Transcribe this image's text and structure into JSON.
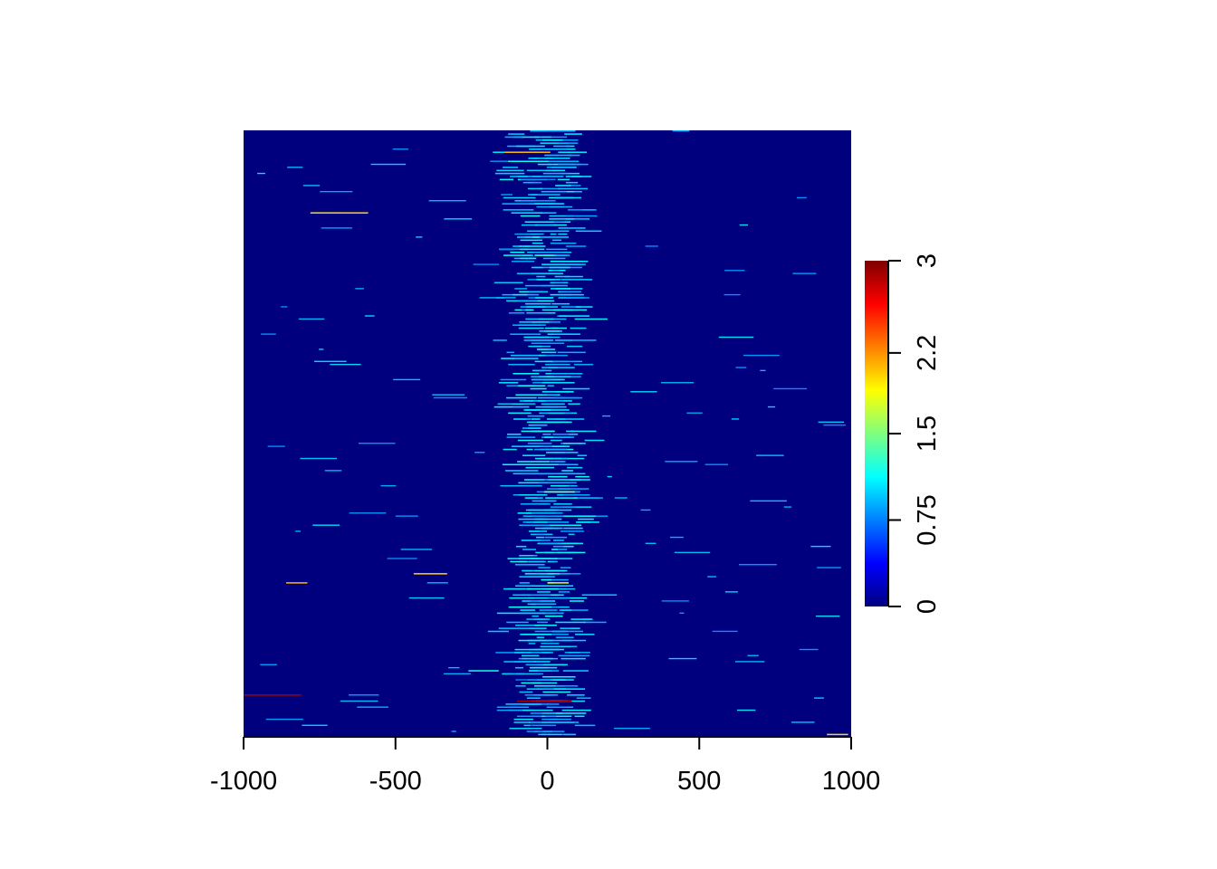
{
  "chart_data": {
    "type": "heatmap",
    "title": "",
    "xlabel": "",
    "ylabel": "",
    "xlim": [
      -1000,
      1000
    ],
    "x_ticks": [
      -1000,
      -500,
      0,
      500,
      1000
    ],
    "x_tick_labels": [
      "-1000",
      "-500",
      "0",
      "500",
      "1000"
    ],
    "rows": 200,
    "background_value": 0,
    "colorbar": {
      "range": [
        0,
        3
      ],
      "ticks": [
        0,
        0.75,
        1.5,
        2.2,
        3
      ],
      "tick_labels": [
        "0",
        "0.75",
        "1.5",
        "2.2",
        "3"
      ],
      "colormap": "jet",
      "colors": [
        "#00007F",
        "#0000FF",
        "#007FFF",
        "#00FFFF",
        "#7FFF7F",
        "#FFFF00",
        "#FF7F00",
        "#FF0000",
        "#7F0000"
      ]
    },
    "segments": [
      {
        "row": 7,
        "x0": -140,
        "x1": 10,
        "value": 2.1
      },
      {
        "row": 27,
        "x0": -780,
        "x1": -590,
        "value": 2.0
      },
      {
        "row": 119,
        "x0": -10,
        "x1": 90,
        "value": 1.6
      },
      {
        "row": 146,
        "x0": -440,
        "x1": -330,
        "value": 2.0
      },
      {
        "row": 149,
        "x0": -860,
        "x1": -790,
        "value": 2.1
      },
      {
        "row": 149,
        "x0": 0,
        "x1": 70,
        "value": 1.8
      },
      {
        "row": 186,
        "x0": -1000,
        "x1": -810,
        "value": 2.9
      },
      {
        "row": 188,
        "x0": -100,
        "x1": 80,
        "value": 2.9
      },
      {
        "row": 199,
        "x0": 920,
        "x1": 990,
        "value": 2.0
      },
      {
        "row": 55,
        "x0": -40,
        "x1": 20,
        "value": 1.1
      },
      {
        "row": 59,
        "x0": 20,
        "x1": 130,
        "value": 1.1
      },
      {
        "row": 96,
        "x0": -60,
        "x1": 50,
        "value": 1.1
      },
      {
        "row": 178,
        "x0": -260,
        "x1": -160,
        "value": 1.2
      },
      {
        "row": 41,
        "x0": -40,
        "x1": 20,
        "value": 1.2
      }
    ]
  }
}
